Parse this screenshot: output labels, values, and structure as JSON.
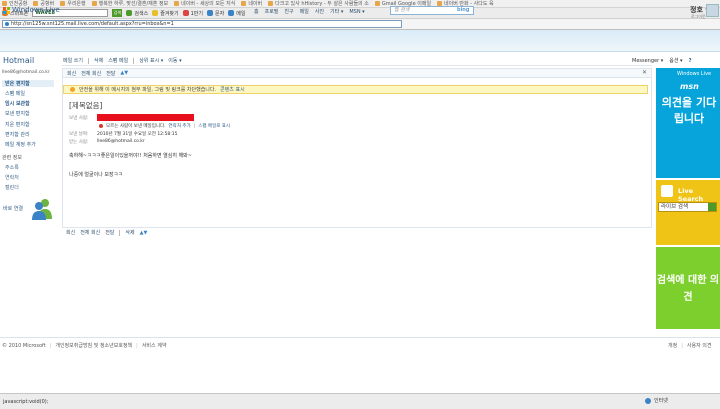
{
  "bookmarks": [
    "인천공항",
    "공항버",
    "우리은행",
    "행복한 하루, 맞선/결혼/재혼 정보",
    "네이버 - 세상의 모든 지식",
    "네이버",
    "다크고 있사 hHistory - 두 살은 사람들의 소",
    "Gmail Google 이메일",
    "네이버 만화 - 사다도 육"
  ],
  "toolbar": {
    "brand": "스마트폰",
    "search_value": "WAVE8",
    "go": "검색",
    "items": [
      "검색스",
      "즐겨찾기",
      "1만기",
      "문자",
      "메일"
    ]
  },
  "address": "http://sn125w.snt125.mail.live.com/default.aspx?rru=inbox&n=1",
  "header": {
    "logo": "Windows Live",
    "nav": [
      "홈",
      "프로필",
      "친구",
      "메일",
      "사진",
      "기타 ▾",
      "MSN ▾"
    ],
    "search_placeholder": "웹 검색",
    "bing": "bing",
    "user_name": "정호 ▾",
    "user_sub": "로그아웃"
  },
  "sidebar": {
    "title": "Hotmail",
    "email": "llee86@hotmail.co.kr",
    "items": [
      "받은 편지함",
      "스팸 메일",
      "임시 보관함",
      "보낸 편지함",
      "지운 편지함",
      "편지함 관리",
      "메일 계정 추가",
      "관련 정보",
      "주소록",
      "연락처",
      "캘린더"
    ],
    "messenger": "바로 연결"
  },
  "command_bar": {
    "items": [
      "메일 쓰기",
      "삭제",
      "스팸 메일",
      "상위 표시 ▾",
      "이동 ▾"
    ],
    "messenger": "Messenger ▾",
    "options": "옵션 ▾"
  },
  "message_toolbar": [
    "회신",
    "전체 회신",
    "전달"
  ],
  "warning": {
    "text": "안전을 위해 이 메시지의 첨부 파일, 그림 및 링크를 차단했습니다.",
    "link": "콘텐츠 표시"
  },
  "message": {
    "subject": "[제목없음]",
    "from_label": "보낸 사람:",
    "sender_status": "모르는 사람이 보낸 메일입니다.",
    "add_contact": "연락처 추가",
    "mark_spam": "스팸 메일로 표시",
    "date_label": "보낸 날짜:",
    "date": "2010년 7월 31일 수요일 오전 12:58:15",
    "to_label": "받는 사람:",
    "to": "llee86@hotmail.co.kr",
    "body_line1": "축하해~ㅋㅋㅋ좋은일이있을꺼야!! 처음하면 열심히 해봐~",
    "body_line2": "나중에 얼굴이나 보장ㅋㅋ"
  },
  "bottom_toolbar": [
    "회신",
    "전체 회신",
    "전달",
    "삭제"
  ],
  "ads": {
    "ad1_brand": "msn",
    "ad1_top": "Windows Live",
    "ad1_text": "의견을 기다립니다",
    "ad2_title": "Live Search",
    "ad2_input": "라이브 검색",
    "ad3_text": "검색에 대한 의견"
  },
  "footer": {
    "left": [
      "© 2010 Microsoft",
      "개인정보취급방침 및 청소년보호정책",
      "서비스 계약"
    ],
    "right": [
      "개정",
      "사용자 의견"
    ]
  },
  "status": {
    "url": "javascript:void(0);",
    "zone": "인터넷"
  },
  "colors": {
    "brand_blue": "#2d5a87",
    "ad_blue": "#06a4da",
    "ad_yellow": "#f0c416",
    "ad_green": "#7dcf2d",
    "warning_bg": "#fff7c2",
    "redaction": "#e8101c"
  }
}
